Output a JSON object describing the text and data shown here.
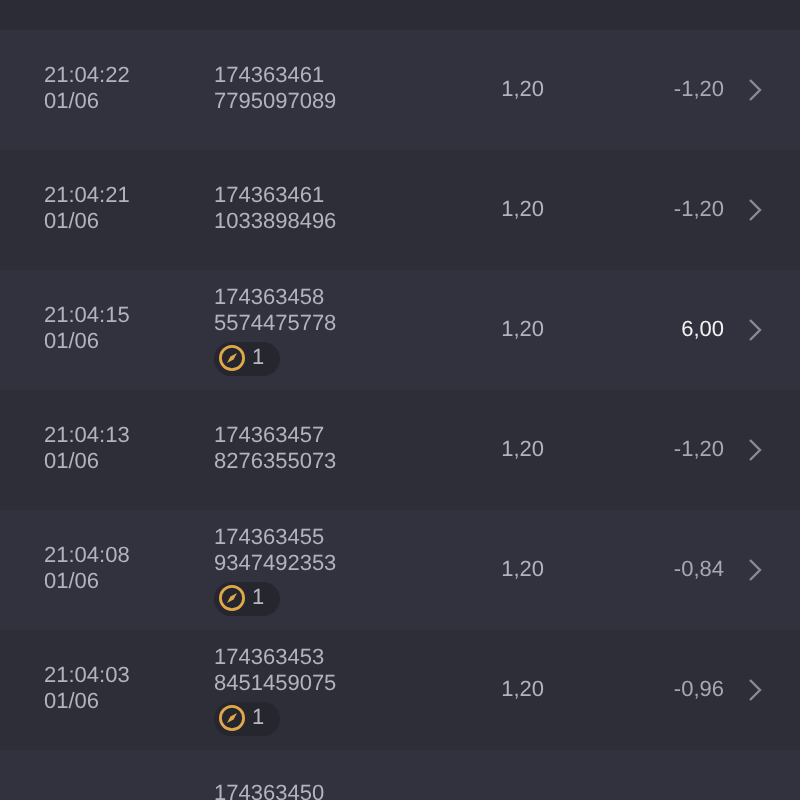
{
  "rows": [
    {
      "time": "21:04:22",
      "date": "01/06",
      "id_1": "174363461",
      "id_2": "7795097089",
      "stake": "1,20",
      "result": "-1,20",
      "won": false
    },
    {
      "time": "21:04:21",
      "date": "01/06",
      "id_1": "174363461",
      "id_2": "1033898496",
      "stake": "1,20",
      "result": "-1,20",
      "won": false
    },
    {
      "time": "21:04:15",
      "date": "01/06",
      "id_1": "174363458",
      "id_2": "5574475778",
      "badge": "1",
      "stake": "1,20",
      "result": "6,00",
      "won": true
    },
    {
      "time": "21:04:13",
      "date": "01/06",
      "id_1": "174363457",
      "id_2": "8276355073",
      "stake": "1,20",
      "result": "-1,20",
      "won": false
    },
    {
      "time": "21:04:08",
      "date": "01/06",
      "id_1": "174363455",
      "id_2": "9347492353",
      "badge": "1",
      "stake": "1,20",
      "result": "-0,84",
      "won": false
    },
    {
      "time": "21:04:03",
      "date": "01/06",
      "id_1": "174363453",
      "id_2": "8451459075",
      "badge": "1",
      "stake": "1,20",
      "result": "-0,96",
      "won": false
    }
  ],
  "partial_row": {
    "id_1": "174363450"
  }
}
